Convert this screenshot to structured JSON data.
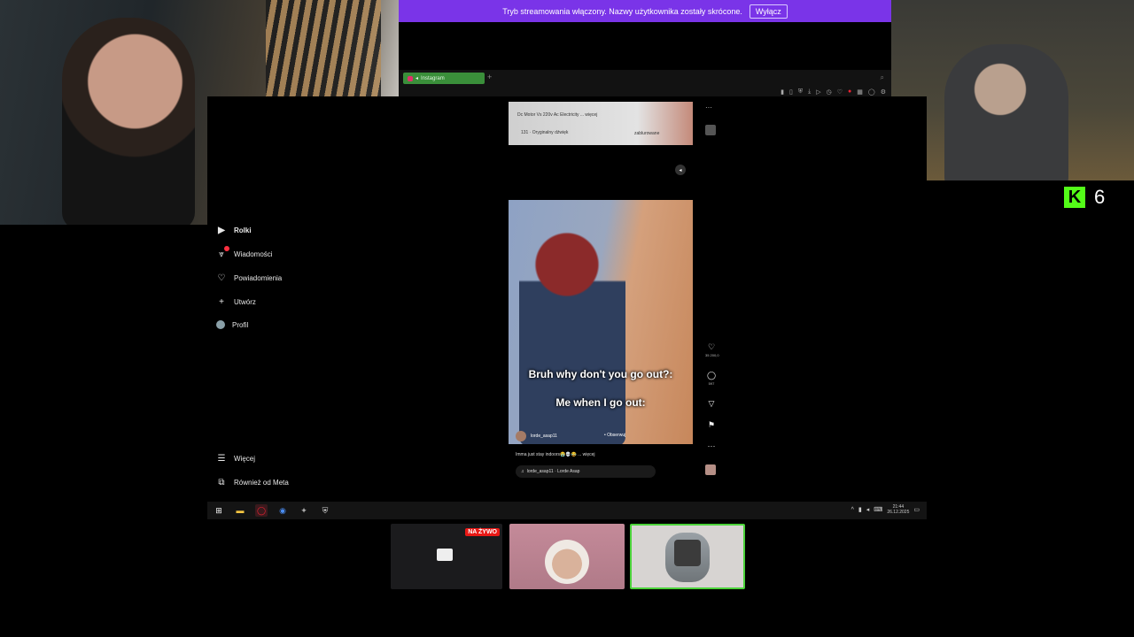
{
  "banner": {
    "text": "Tryb streamowania włączony. Nazwy użytkownika zostały skrócone.",
    "button": "Wyłącz"
  },
  "browser": {
    "tab_title": "Instagram",
    "new_tab": "+"
  },
  "sidebar": {
    "items": [
      {
        "label": "Rolki",
        "icon": "reels-icon"
      },
      {
        "label": "Wiadomości",
        "icon": "messenger-icon"
      },
      {
        "label": "Powiadomienia",
        "icon": "heart-icon"
      },
      {
        "label": "Utwórz",
        "icon": "plus-icon"
      },
      {
        "label": "Profil",
        "icon": "profile-icon"
      },
      {
        "label": "Więcej",
        "icon": "menu-icon"
      },
      {
        "label": "Również od Meta",
        "icon": "meta-icon"
      }
    ]
  },
  "reel_top": {
    "title": "Dc Motor Vs 220v Ac Electricity",
    "more": "... więcej",
    "audio": "131 · Oryginalny dźwięk",
    "status": "zablurowane"
  },
  "reel": {
    "caption_1": "Bruh why don't you go out?:",
    "caption_2": "Me when I go out:",
    "username": "lorde_asap11",
    "follow": "Obserwuj",
    "description": "Imma just stay indoors😭💀😂 ... więcej",
    "audio": "lorde_asap11 · Lorde Asap",
    "likes": "35 200,0",
    "comments": "597"
  },
  "taskbar": {
    "time": "21:44",
    "date": "26.12.2025"
  },
  "kick": {
    "logo": "K",
    "viewers": "6"
  },
  "streams": {
    "live_badge": "NA ŻYWO"
  }
}
